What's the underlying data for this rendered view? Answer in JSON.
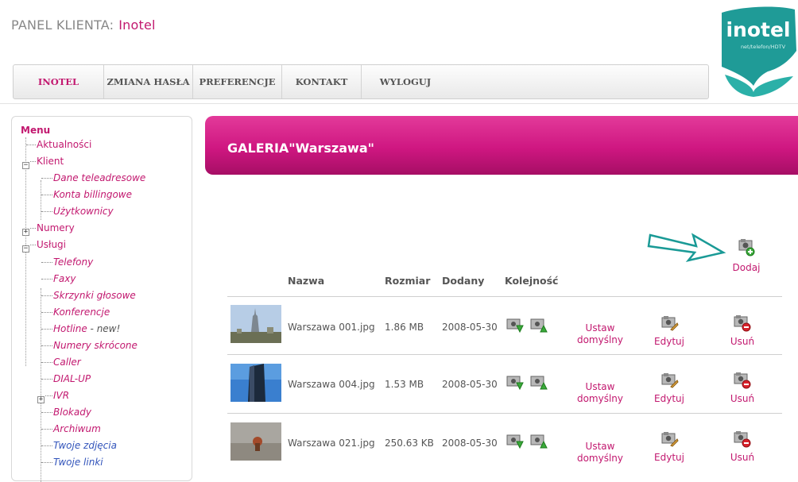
{
  "header": {
    "panel_label": "PANEL KLIENTA:",
    "client_name": "Inotel"
  },
  "logo": {
    "name": "inotel",
    "tagline": "net/telefon/HDTV"
  },
  "nav": {
    "items": [
      "INOTEL",
      "ZMIANA HASŁA",
      "PREFERENCJE",
      "KONTAKT",
      "WYLOGUJ"
    ],
    "active": "INOTEL"
  },
  "sidebar": {
    "title": "Menu",
    "items": {
      "aktualnosci": "Aktualności",
      "klient": "Klient",
      "dane": "Dane teleadresowe",
      "konta": "Konta billingowe",
      "uzytkownicy": "Użytkownicy",
      "numery": "Numery",
      "uslugi": "Usługi",
      "telefony": "Telefony",
      "faxy": "Faxy",
      "skrzynki": "Skrzynki głosowe",
      "konferencje": "Konferencje",
      "hotline": "Hotline",
      "hotline_new": " - new!",
      "numery_skrocone": "Numery skrócone",
      "caller": "Caller",
      "dialup": "DIAL-UP",
      "ivr": "IVR",
      "blokady": "Blokady",
      "archiwum": "Archiwum",
      "zdjecia": "Twoje zdjęcia",
      "linki": "Twoje linki"
    }
  },
  "gallery": {
    "title": "GALERIA\"Warszawa\"",
    "add_label": "Dodaj",
    "columns": {
      "name": "Nazwa",
      "size": "Rozmiar",
      "added": "Dodany",
      "order": "Kolejność"
    },
    "actions": {
      "set_default": "Ustaw domyślny",
      "edit": "Edytuj",
      "delete": "Usuń"
    },
    "rows": [
      {
        "name": "Warszawa 001.jpg",
        "size": "1.86 MB",
        "date": "2008-05-30"
      },
      {
        "name": "Warszawa 004.jpg",
        "size": "1.53 MB",
        "date": "2008-05-30"
      },
      {
        "name": "Warszawa 021.jpg",
        "size": "250.63 KB",
        "date": "2008-05-30"
      }
    ]
  },
  "colors": {
    "accent": "#c2186f",
    "logo_teal": "#1f9b97"
  }
}
